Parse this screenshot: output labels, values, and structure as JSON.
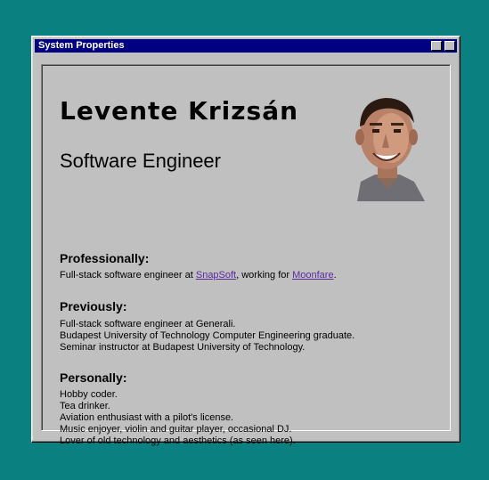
{
  "window": {
    "title": "System Properties"
  },
  "profile": {
    "name": "Levente Krizsán",
    "role": "Software Engineer"
  },
  "professionally": {
    "heading": "Professionally:",
    "text_1": "Full-stack software engineer at ",
    "link_1": "SnapSoft",
    "text_2": ", working for ",
    "link_2": "Moonfare",
    "text_3": "."
  },
  "previously": {
    "heading": "Previously:",
    "lines": [
      "Full-stack software engineer at Generali.",
      "Budapest University of Technology Computer Engineering graduate.",
      "Seminar instructor at Budapest University of Technology."
    ]
  },
  "personally": {
    "heading": "Personally:",
    "lines": [
      "Hobby coder.",
      "Tea drinker.",
      "Aviation enthusiast with a pilot's license.",
      "Music enjoyer, violin and guitar player, occasional DJ.",
      "Lover of old technology and aesthetics (as seen here)."
    ]
  },
  "colors": {
    "desktop": "#0b8080",
    "titlebar": "#000080",
    "window": "#c0c0c0",
    "link": "#5a2aa0"
  }
}
